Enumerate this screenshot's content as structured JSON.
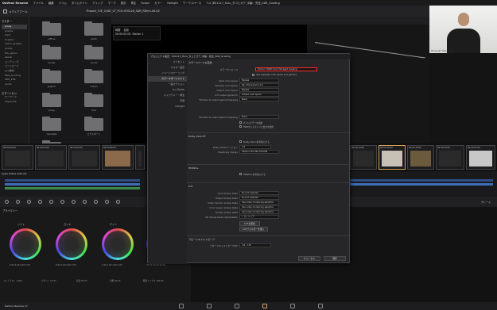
{
  "menubar": {
    "app": "DaVinci Resolve",
    "items": [
      "ファイル",
      "編集",
      "トリム",
      "タイムライン",
      "クリップ",
      "マーク",
      "表示",
      "再生",
      "Fusion",
      "カラー",
      "Fairlight",
      "ワークスペース",
      "ヘルプ"
    ],
    "window_title": "201117_Hulu_タコとガア_中編・完全_SDR_Grading"
  },
  "toolbar": {
    "media_pool": "メディアプール",
    "clip_name": "Phase4_TVE_CHAT_07_PCH-HT0226_SDR_RTerm-06-02"
  },
  "sidebar": {
    "header": "マスター",
    "items": [
      "proxy",
      "graphs",
      "mp4",
      "Graphic",
      "shikou graphic",
      "anime",
      "tile_sjkhuu",
      "ebook",
      "エンディング",
      "エンドロール",
      "ロゴ素材",
      "SDR_Grading",
      "SDR_Edit",
      "Audio"
    ],
    "selected_index": 0,
    "smart_bins": "スマートビン",
    "smart_items": [
      "キーワード",
      "Keywords"
    ]
  },
  "media": {
    "folders": [
      "offline",
      "photo",
      "render",
      "sound",
      "graphic",
      "motion",
      "proxy",
      "font",
      "template",
      "エクスポート",
      "オーディオ"
    ]
  },
  "viewer": {
    "marker_label": "時間",
    "marker_name": "名前",
    "marker_time": "00:00:02:00",
    "marker_value": "Marker 1"
  },
  "webcam": {
    "name": "Hiroyuki Yamamoto"
  },
  "timeline": {
    "clip_tcs": [
      "00:00:00:00",
      "00:00:02:00",
      "00:00:04:00",
      "00:00:06:00",
      "00:00:08:00",
      "00:00:10:00",
      "00:00:12:00",
      "00:00:14:00",
      "00:00:16:00",
      "00:00:18:00",
      "00:00:20:00",
      "00:00:22:00"
    ],
    "track_label": "Apple ProRes 4444 XQ",
    "bottom_label": "プライマリー",
    "right_label": "グレード"
  },
  "wheels": {
    "labels": [
      "リフト",
      "ガンマ",
      "ゲイン",
      "オフセット"
    ],
    "values": [
      "0.00  0.00  0.00  0.00",
      "0.00  0.00  0.00  0.00",
      "1.00  1.00  1.00  1.00",
      "25.00  25.00  25.00"
    ],
    "footer": [
      "コントラスト 1.000",
      "ピボット 0.435",
      "彩度 50.00",
      "色相 50.00",
      "輝度ミックス 100.00"
    ]
  },
  "bottombar": {
    "app": "DaVinci Resolve 17"
  },
  "dialog": {
    "title": "プロジェクト設定：201117_Hulu_タコとガア_中編・完全_SDR_Grading",
    "nav": [
      "プリセット",
      "マスター設定",
      "イメージスケーリング",
      "カラーマネージメント",
      "一般オプション",
      "カメラRAW",
      "キャプチャー・再生",
      "字幕",
      "Fairlight"
    ],
    "nav_selected": 3,
    "section_color_space": "カラースペース＆変換",
    "rows": [
      {
        "label": "カラーサイエンス",
        "value": "DaVinci YRGB Color Managed (Legacy)"
      },
      {
        "label": "",
        "value": "Use separate color space and gamma"
      },
      {
        "label": "Input color space",
        "value": "Bypass"
      },
      {
        "label": "Timeline color space",
        "value": "Rec.709 Gamma 2.4"
      },
      {
        "label": "Output color space",
        "value": "Bypass"
      },
      {
        "label": "LUT output gamut to",
        "value": "Output color space"
      },
      {
        "label": "Timeline to output gamut mapping",
        "value": "None"
      },
      {
        "label": "",
        "value": ""
      },
      {
        "label": "Timeline to output gamut mapping",
        "value": "None"
      }
    ],
    "checks_a": [
      "ビンにカラーを適用",
      "HDRタイムラインに出力を使用"
    ],
    "section_dolby": "Dolby Vision®",
    "dolby_check": "Dolby Visionを有効にする",
    "dolby_rows": [
      {
        "label": "Dolby Visionバージョン",
        "value": "4.0"
      },
      {
        "label": "Mastering display",
        "value": "4000-nit P3 D65 ST.2084"
      }
    ],
    "section_hdr": "HDR10+",
    "hdr_check": "HDR10+を有効にする",
    "section_lut": "LUT",
    "lut_rows": [
      {
        "label": "Input lookup table",
        "value": "No LUT selected"
      },
      {
        "label": "Output lookup table",
        "value": "No LUT selected"
      },
      {
        "label": "Video monitor lookup table",
        "value": "Use video monitoring selection"
      },
      {
        "label": "Color viewer lookup table",
        "value": "Use video monitoring selection"
      },
      {
        "label": "Scopes lookup table",
        "value": "Use video monitoring selection"
      },
      {
        "label": "3D lookup table interpolation",
        "value": "トライリニア"
      }
    ],
    "lut_buttons": [
      "LUTを更新",
      "LUTフォルダーを開く"
    ],
    "section_broadcast": "ブロードキャストセーフ",
    "broadcast_row": {
      "label": "ブロードキャストセーフIRE",
      "value": "-20 - 120"
    },
    "cancel": "キャンセル",
    "save": "保存"
  }
}
